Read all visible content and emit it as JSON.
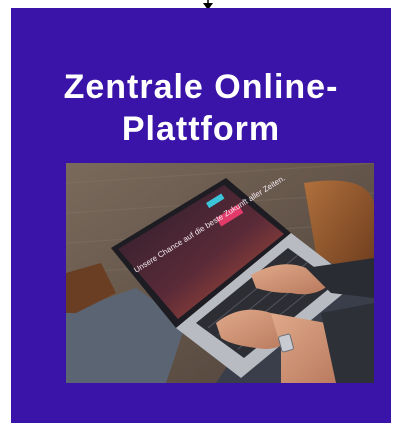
{
  "card": {
    "title_line_1": "Zentrale Online-",
    "title_line_2": "Plattform",
    "background_color": "#3a14a8",
    "text_color": "#ffffff"
  },
  "photo": {
    "screen_text": "Unsere Chance auf die beste Zukunft aller Zeiten."
  },
  "icons": {
    "connector": "arrow-down-icon"
  }
}
